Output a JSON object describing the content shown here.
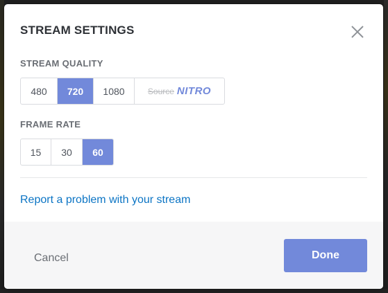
{
  "modal": {
    "title": "STREAM SETTINGS",
    "close_icon": "close-icon"
  },
  "stream_quality": {
    "label": "STREAM QUALITY",
    "options": [
      {
        "label": "480",
        "selected": false
      },
      {
        "label": "720",
        "selected": true
      },
      {
        "label": "1080",
        "selected": false
      }
    ],
    "source": {
      "label": "Source",
      "disabled": true
    },
    "nitro_badge": "NITRO"
  },
  "frame_rate": {
    "label": "FRAME RATE",
    "options": [
      {
        "label": "15",
        "selected": false
      },
      {
        "label": "30",
        "selected": false
      },
      {
        "label": "60",
        "selected": true
      }
    ]
  },
  "report_link": "Report a problem with your stream",
  "footer": {
    "cancel_label": "Cancel",
    "done_label": "Done"
  },
  "colors": {
    "accent": "#7289da",
    "link": "#0b74c4",
    "footer_bg": "#f6f6f7"
  }
}
